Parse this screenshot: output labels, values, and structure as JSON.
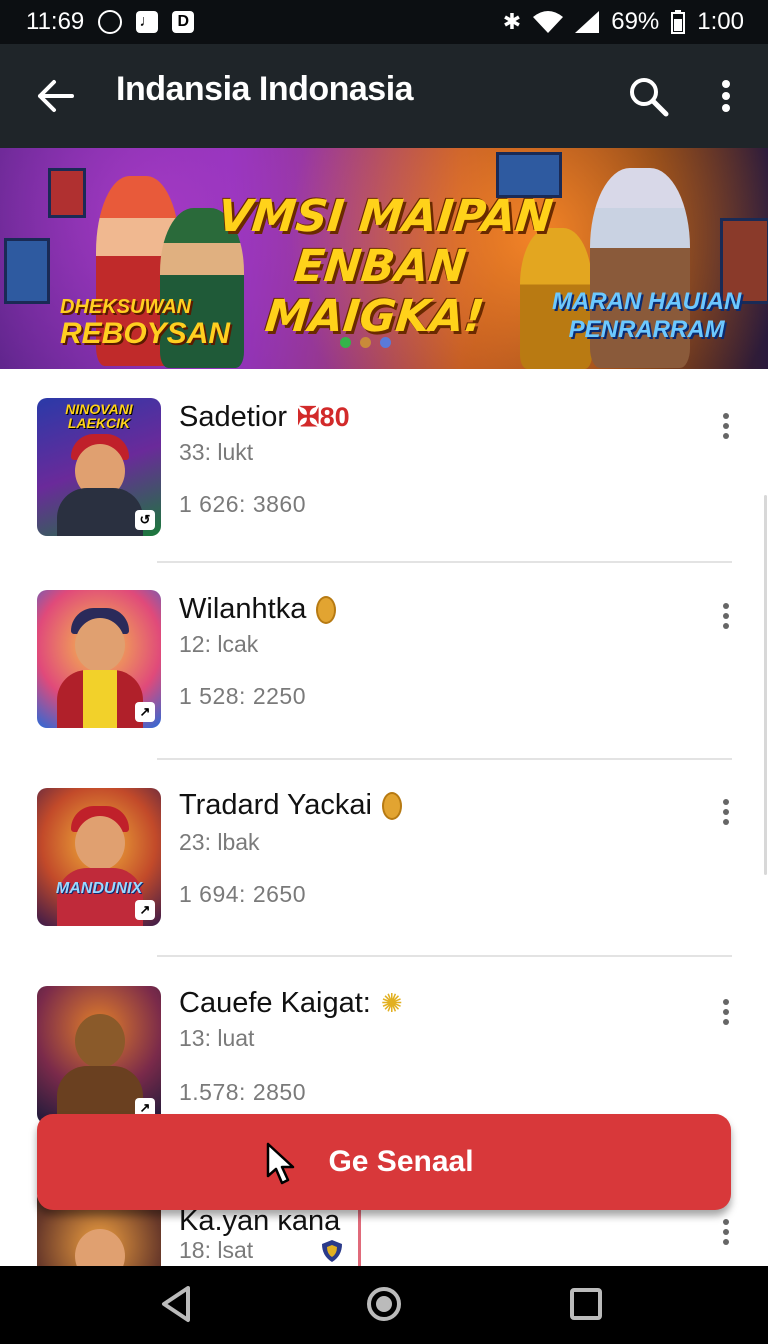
{
  "status": {
    "time": "11:69",
    "battery": "69%",
    "clock": "1:00",
    "box_d": "D"
  },
  "appbar": {
    "title": "Indansia Indonasia"
  },
  "banner": {
    "headline_1": "VMSI MAIPAN",
    "headline_2": "ENBAN MAIGKA!",
    "tag_left_1": "DHEKSUWAN",
    "tag_left_2": "REBOYSAN",
    "tag_right_1": "MARAN HAUIAN",
    "tag_right_2": "PENRARRAM",
    "dots": [
      "#35b34a",
      "#c98a3a",
      "#5a7ad8"
    ]
  },
  "items": [
    {
      "name": "Sadetior",
      "flag": "80",
      "sub": "33: lukt",
      "stat": "1 626: 3860",
      "thumb_caption": "NINOVANI LAEKCIK"
    },
    {
      "name": "Wilanhtka",
      "sub": "12: lcak",
      "stat": "1 528: 2250",
      "thumb_caption": ""
    },
    {
      "name": "Tradard Yackai",
      "sub": "23: lbak",
      "stat": "1 694: 2650",
      "thumb_caption": "MANDUNIX"
    },
    {
      "name": "Cauefe Kaigat:",
      "sub": "13: luat",
      "stat": "1.578: 2850",
      "thumb_caption": ""
    },
    {
      "name": "Ka.yan ĸana",
      "sub": "18: lsat",
      "stat": "",
      "thumb_caption": ""
    }
  ],
  "fab": {
    "label": "Ge Senaal"
  },
  "colors": {
    "accent": "#d8383a",
    "appbar": "#1f2529",
    "statusbar": "#0c0f12"
  }
}
